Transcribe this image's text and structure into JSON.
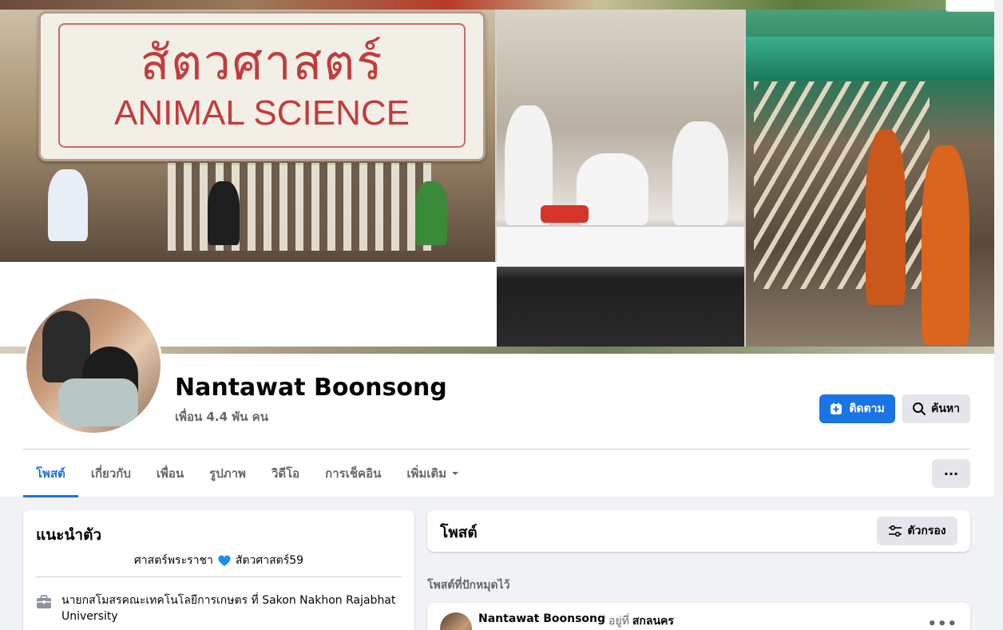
{
  "cover": {
    "sign_thai": "สัตวศาสตร์",
    "sign_english": "ANIMAL SCIENCE"
  },
  "profile": {
    "name": "Nantawat Boonsong",
    "friends": "เพื่อน 4.4 พัน คน"
  },
  "actions": {
    "follow_label": "ติดตาม",
    "search_label": "ค้นหา",
    "more_label": "···"
  },
  "tabs": [
    {
      "label": "โพสต์",
      "active": true
    },
    {
      "label": "เกี่ยวกับ",
      "active": false
    },
    {
      "label": "เพื่อน",
      "active": false
    },
    {
      "label": "รูปภาพ",
      "active": false
    },
    {
      "label": "วิดีโอ",
      "active": false
    },
    {
      "label": "การเช็คอิน",
      "active": false
    },
    {
      "label": "เพิ่มเติม",
      "active": false
    }
  ],
  "intro": {
    "title": "แนะนำตัว",
    "bio_left": "ศาสตร์พระราชา",
    "bio_right": "สัตวศาสตร์59",
    "work": "นายกสโมสรคณะเทคโนโลยีการเกษตร ที่ Sakon Nakhon Rajabhat University"
  },
  "posts": {
    "title": "โพสต์",
    "filter_label": "ตัวกรอง",
    "pinned_label": "โพสต์ที่ปักหมุดไว้",
    "first_post": {
      "author": "Nantawat Boonsong",
      "at_text": "อยู่ที่",
      "place": "สกลนคร"
    }
  },
  "colors": {
    "accent": "#1b74e4",
    "background": "#f0f2f5",
    "secondary_text": "#65676b",
    "button_gray": "#e4e6eb"
  }
}
